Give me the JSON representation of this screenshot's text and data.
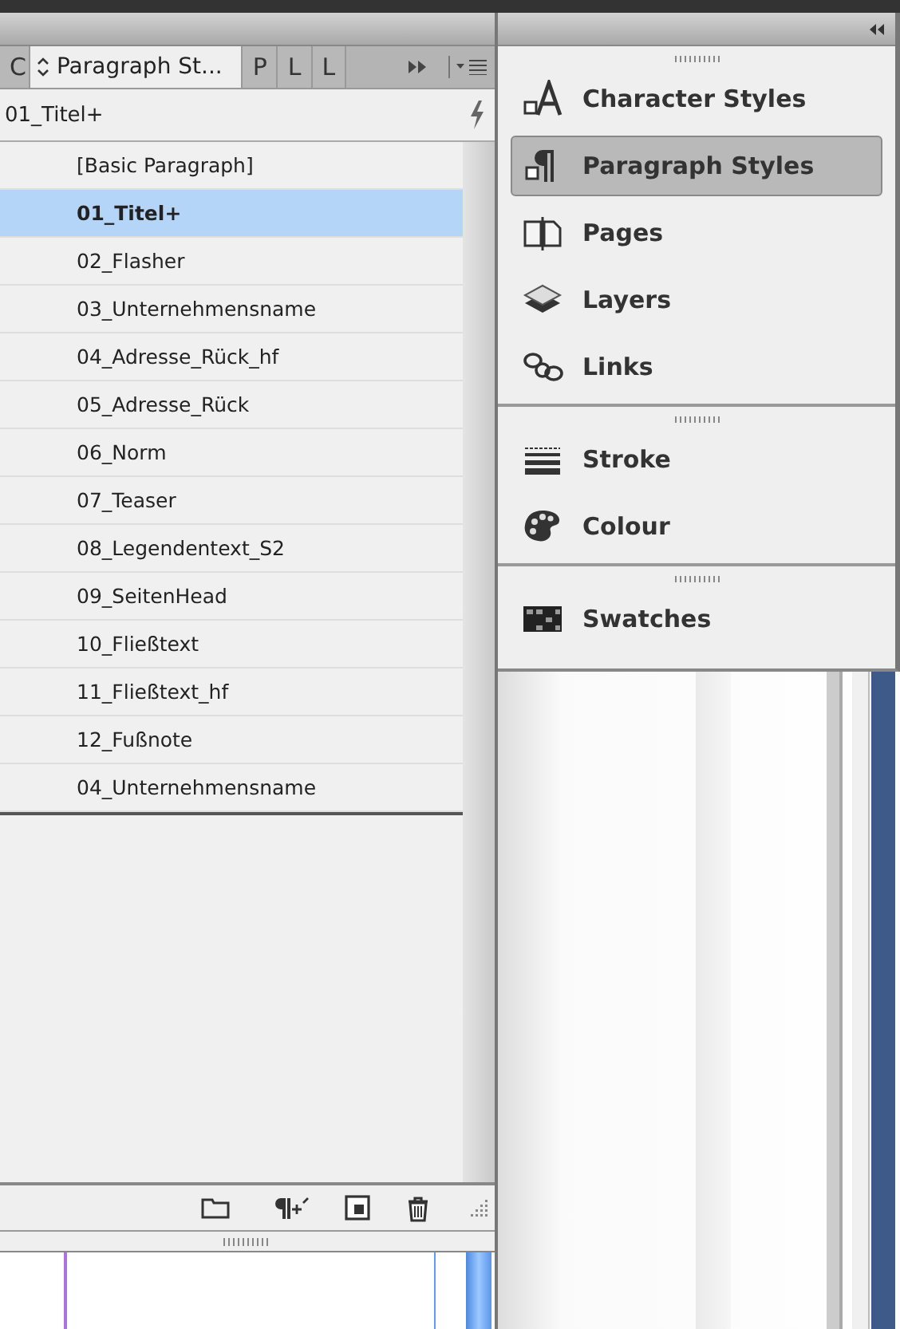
{
  "styles_panel": {
    "tabs": [
      {
        "label": "C",
        "selected": false
      },
      {
        "label": "Paragraph St...",
        "selected": true
      },
      {
        "label": "P",
        "selected": false
      },
      {
        "label": "L",
        "selected": false
      },
      {
        "label": "L",
        "selected": false
      }
    ],
    "current_style": "01_Titel+",
    "styles": [
      {
        "name": "[Basic Paragraph]",
        "selected": false
      },
      {
        "name": "01_Titel+",
        "selected": true
      },
      {
        "name": "02_Flasher",
        "selected": false
      },
      {
        "name": "03_Unternehmensname",
        "selected": false
      },
      {
        "name": "04_Adresse_Rück_hf",
        "selected": false
      },
      {
        "name": "05_Adresse_Rück",
        "selected": false
      },
      {
        "name": "06_Norm",
        "selected": false
      },
      {
        "name": "07_Teaser",
        "selected": false
      },
      {
        "name": "08_Legendentext_S2",
        "selected": false
      },
      {
        "name": "09_SeitenHead",
        "selected": false
      },
      {
        "name": "10_Fließtext",
        "selected": false
      },
      {
        "name": "11_Fließtext_hf",
        "selected": false
      },
      {
        "name": "12_Fußnote",
        "selected": false
      },
      {
        "name": "04_Unternehmensname",
        "selected": false
      }
    ]
  },
  "dock": {
    "groups": [
      {
        "items": [
          {
            "kind": "character",
            "label": "Character Styles",
            "selected": false
          },
          {
            "kind": "paragraph",
            "label": "Paragraph Styles",
            "selected": true
          },
          {
            "kind": "pages",
            "label": "Pages",
            "selected": false
          },
          {
            "kind": "layers",
            "label": "Layers",
            "selected": false
          },
          {
            "kind": "links",
            "label": "Links",
            "selected": false
          }
        ]
      },
      {
        "items": [
          {
            "kind": "stroke",
            "label": "Stroke",
            "selected": false
          },
          {
            "kind": "colour",
            "label": "Colour",
            "selected": false
          }
        ]
      },
      {
        "items": [
          {
            "kind": "swatches",
            "label": "Swatches",
            "selected": false
          }
        ]
      }
    ]
  }
}
